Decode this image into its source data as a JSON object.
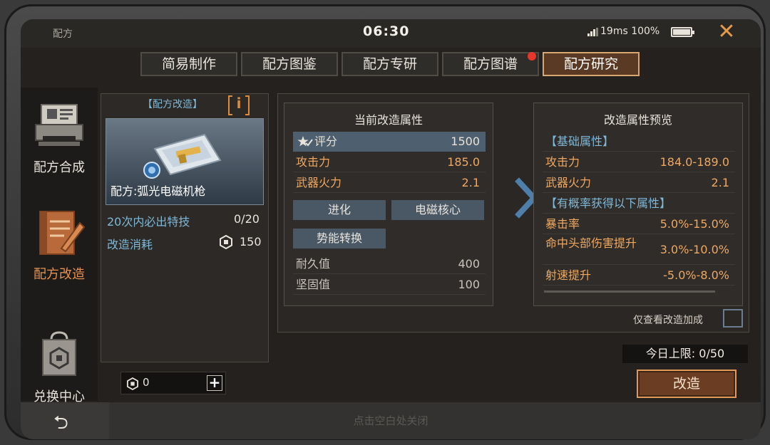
{
  "statusbar": {
    "title": "配方",
    "time": "06:30",
    "network": "19ms 100%",
    "battery_level": 1.0
  },
  "tabs": [
    {
      "label": "简易制作",
      "active": false,
      "notify": false
    },
    {
      "label": "配方图鉴",
      "active": false,
      "notify": false
    },
    {
      "label": "配方专研",
      "active": false,
      "notify": false
    },
    {
      "label": "配方图谱",
      "active": false,
      "notify": true
    },
    {
      "label": "配方研究",
      "active": true,
      "notify": false
    }
  ],
  "rail": {
    "synth": "配方合成",
    "modify": "配方改造",
    "exchange": "兑换中心"
  },
  "card": {
    "title": "【配方改造】",
    "info_glyph": "i",
    "item_name": "配方:弧光电磁机枪",
    "guarantee_label": "20次内必出特技",
    "guarantee_value": "0/20",
    "cost_label": "改造消耗",
    "cost_value": "150"
  },
  "counter": {
    "value": "0",
    "plus": "+"
  },
  "current": {
    "title": "当前改造属性",
    "score_label": "评分",
    "score_value": "1500",
    "attack_label": "攻击力",
    "attack_value": "185.0",
    "fire_label": "武器火力",
    "fire_value": "2.1",
    "chips": [
      "进化",
      "电磁核心",
      "势能转换"
    ],
    "durability_label": "耐久值",
    "durability_value": "400",
    "solid_label": "坚固值",
    "solid_value": "100"
  },
  "preview": {
    "title": "改造属性预览",
    "base_header": "【基础属性】",
    "attack_label": "攻击力",
    "attack_value": "184.0-189.0",
    "fire_label": "武器火力",
    "fire_value": "2.1",
    "chance_header": "【有概率获得以下属性】",
    "crit_label": "暴击率",
    "crit_value": "5.0%-15.0%",
    "head_label": "命中头部伤害提升",
    "head_value": "3.0%-10.0%",
    "rate_label": "射速提升",
    "rate_value": "-5.0%-8.0%"
  },
  "only_view_label": "仅查看改造加成",
  "daily_limit": "今日上限: 0/50",
  "modify_button": "改造",
  "tap_close": "点击空白处关闭",
  "colors": {
    "accent_orange": "#e6914e",
    "info_blue": "#7fb8d8",
    "highlight_row": "#4e5f70",
    "chip_bg": "#4a5866"
  }
}
